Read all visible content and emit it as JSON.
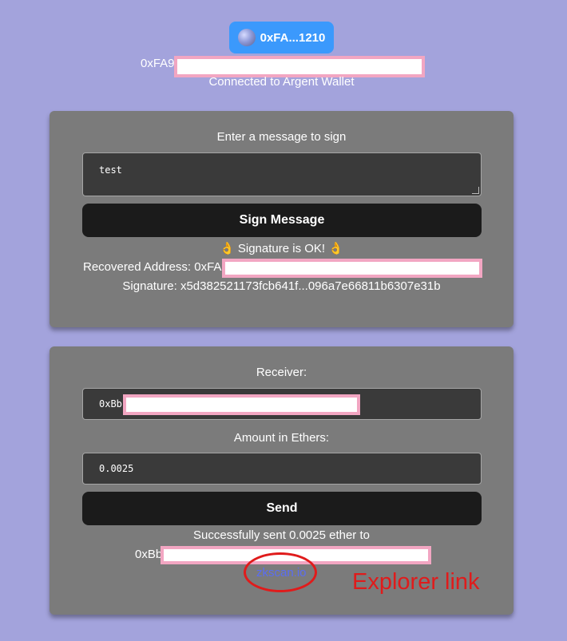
{
  "header": {
    "wallet_button_label": "0xFA...1210",
    "address_prefix": "0xFA9",
    "connected_text": "Connected to Argent Wallet"
  },
  "sign_card": {
    "prompt_label": "Enter a message to sign",
    "message_value": "test",
    "sign_button_label": "Sign Message",
    "status_text": "👌 Signature is OK! 👌",
    "recovered_address_label": "Recovered Address: 0xFA",
    "signature_text": "Signature: x5d382521173fcb641f...096a7e66811b6307e31b"
  },
  "send_card": {
    "receiver_label": "Receiver:",
    "receiver_value_prefix": "0xBb",
    "amount_label": "Amount in Ethers:",
    "amount_value": "0.0025",
    "send_button_label": "Send",
    "success_text": "Successfully sent 0.0025 ether to",
    "recipient_prefix": "0xBb",
    "explorer_link_text": "zkscan.io"
  },
  "annotation": {
    "text": "Explorer link",
    "color": "#e01b1b"
  },
  "colors": {
    "background": "#a3a3dc",
    "wallet_button": "#3b99fc",
    "card": "#7b7b7b",
    "dark_button": "#1b1b1b",
    "redaction_border": "#f2a6c2"
  }
}
